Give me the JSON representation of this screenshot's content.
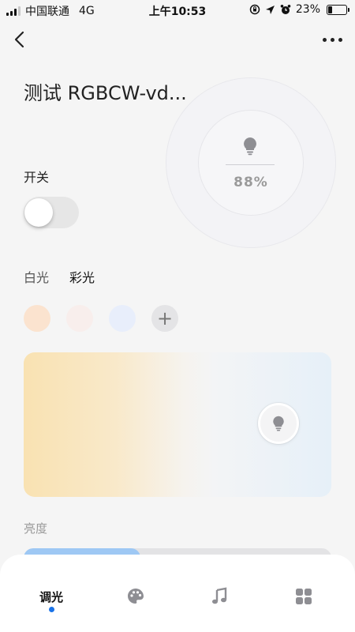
{
  "status_bar": {
    "carrier": "中国联通",
    "network": "4G",
    "time": "上午10:53",
    "battery_text": "23%",
    "battery_level": 0.23
  },
  "device": {
    "title": "测试 RGBCW-vd..."
  },
  "dial": {
    "value_text": "88%",
    "icon": "bulb-icon"
  },
  "switch": {
    "label": "开关",
    "state": "off"
  },
  "mode_tabs": [
    {
      "label": "白光",
      "active": false
    },
    {
      "label": "彩光",
      "active": true
    }
  ],
  "swatches": [
    {
      "color": "#fbe3cf"
    },
    {
      "color": "#f8eeec"
    },
    {
      "color": "#e8eefb"
    }
  ],
  "swatch_add_label": "+",
  "temperature_panel": {
    "warm_color": "#f9e2b2",
    "cool_color": "#e6f0f8",
    "handle_icon": "bulb-icon"
  },
  "brightness": {
    "label": "亮度",
    "level": 0.38,
    "fill_color": "#9ec8f4"
  },
  "bottom_nav": {
    "items": [
      {
        "label": "调光",
        "active": true
      },
      {
        "icon": "palette-icon"
      },
      {
        "icon": "music-icon"
      },
      {
        "icon": "grid-icon"
      }
    ],
    "active_dot_color": "#1a73e8"
  }
}
